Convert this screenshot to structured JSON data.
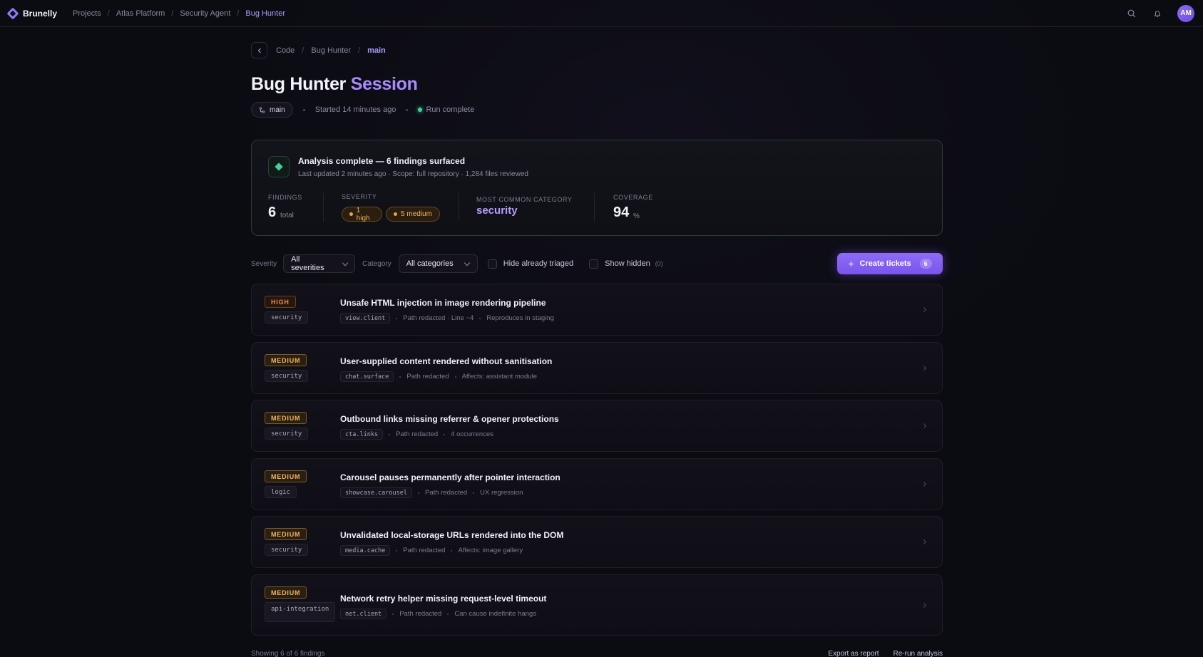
{
  "nav": {
    "brand": "Brunelly",
    "crumbs": [
      "Projects",
      "Atlas Platform",
      "Security Agent",
      "Bug Hunter"
    ],
    "avatar": "AM"
  },
  "page": {
    "crumbs": [
      "Code",
      "Bug Hunter",
      "main"
    ],
    "title_main": "Bug Hunter",
    "title_accent": "Session",
    "branch": "main",
    "started": "Started 14 minutes ago",
    "status": "Run complete"
  },
  "summary": {
    "title": "Analysis complete — 6 findings surfaced",
    "subtitle": "Last updated 2 minutes ago · Scope: full repository · 1,284 files reviewed",
    "findings_label": "FINDINGS",
    "findings_value": "6",
    "findings_unit": "total",
    "severity_label": "SEVERITY",
    "severity_high": "1 high",
    "severity_medium": "5 medium",
    "common_label": "MOST COMMON CATEGORY",
    "common_value": "security",
    "coverage_label": "COVERAGE",
    "coverage_value": "94",
    "coverage_unit": "%"
  },
  "filters": {
    "severity_label": "Severity",
    "severity_value": "All severities",
    "category_label": "Category",
    "category_value": "All categories",
    "hide_triaged": "Hide already triaged",
    "show_hidden": "Show hidden",
    "hidden_count": "(0)",
    "create_label": "Create tickets",
    "create_count": "6"
  },
  "findings": [
    {
      "severity": "HIGH",
      "category": "security",
      "title": "Unsafe HTML injection in image rendering pipeline",
      "module": "view.client",
      "path": "Path redacted · Line ~4",
      "note": "Reproduces in staging"
    },
    {
      "severity": "MEDIUM",
      "category": "security",
      "title": "User-supplied content rendered without sanitisation",
      "module": "chat.surface",
      "path": "Path redacted",
      "note": "Affects: assistant module"
    },
    {
      "severity": "MEDIUM",
      "category": "security",
      "title": "Outbound links missing referrer & opener protections",
      "module": "cta.links",
      "path": "Path redacted",
      "note": "4 occurrences"
    },
    {
      "severity": "MEDIUM",
      "category": "logic",
      "title": "Carousel pauses permanently after pointer interaction",
      "module": "showcase.carousel",
      "path": "Path redacted",
      "note": "UX regression"
    },
    {
      "severity": "MEDIUM",
      "category": "security",
      "title": "Unvalidated local-storage URLs rendered into the DOM",
      "module": "media.cache",
      "path": "Path redacted",
      "note": "Affects: image gallery"
    },
    {
      "severity": "MEDIUM",
      "category": "api-integration",
      "title": "Network retry helper missing request-level timeout",
      "module": "net.client",
      "path": "Path redacted",
      "note": "Can cause indefinite hangs"
    }
  ],
  "footer": {
    "showing": "Showing 6 of 6 findings",
    "export": "Export as report",
    "rerun": "Re-run analysis"
  }
}
